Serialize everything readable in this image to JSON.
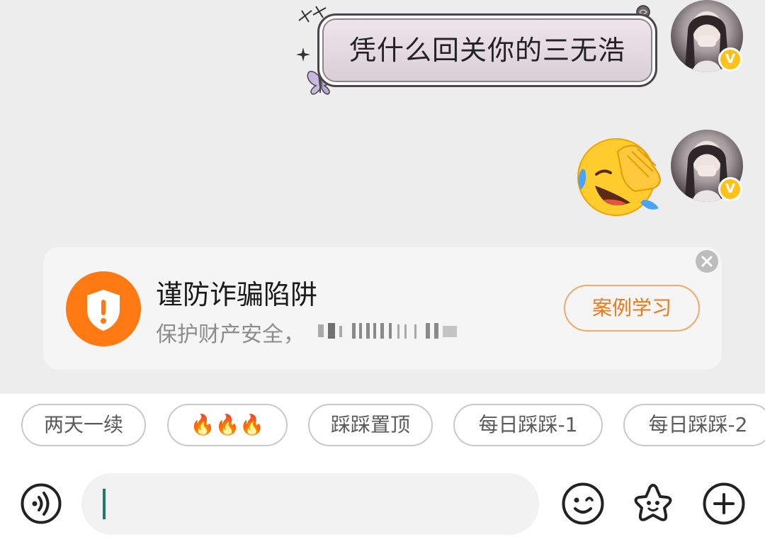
{
  "chat": {
    "messages": [
      {
        "side": "right",
        "type": "text",
        "text": "凭什么回关你的三无浩"
      },
      {
        "side": "right",
        "type": "emoji",
        "emoji": "rolling-on-floor-laughing-facepalm"
      }
    ],
    "verified_badge": "V"
  },
  "fraud_card": {
    "title": "谨防诈骗陷阱",
    "subtitle": "保护财产安全，",
    "action_label": "案例学习",
    "accent_color": "#ff7a12"
  },
  "quick_replies": [
    {
      "label": "两天一续"
    },
    {
      "label": "🔥🔥🔥"
    },
    {
      "label": "踩踩置顶"
    },
    {
      "label": "每日踩踩-1"
    },
    {
      "label": "每日踩踩-2"
    }
  ],
  "input": {
    "value": "",
    "caret_color": "#1f7d64"
  },
  "icons": {
    "voice": "voice-icon",
    "emoji": "emoji-icon",
    "sticker": "sticker-star-icon",
    "more": "plus-icon"
  }
}
